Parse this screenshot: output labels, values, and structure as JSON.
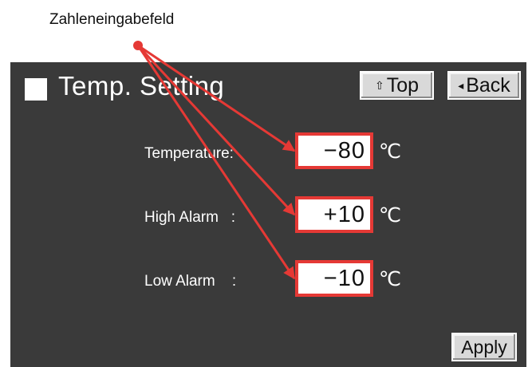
{
  "callout": {
    "label": "Zahleneingabefeld"
  },
  "screen": {
    "title": "Temp. Setting",
    "top_button": {
      "glyph": "⇧",
      "label": "Top"
    },
    "back_button": {
      "glyph": "◂",
      "label": "Back"
    },
    "rows": [
      {
        "label": "Temperature:",
        "value": "−80",
        "unit": "℃"
      },
      {
        "label": "High Alarm   :",
        "value": "+10",
        "unit": "℃"
      },
      {
        "label": "Low Alarm    :",
        "value": "−10",
        "unit": "℃"
      }
    ],
    "apply_label": "Apply"
  },
  "colors": {
    "screen_bg": "#3a3a3a",
    "highlight": "#e53935",
    "button_bg": "#d9d9d9"
  }
}
